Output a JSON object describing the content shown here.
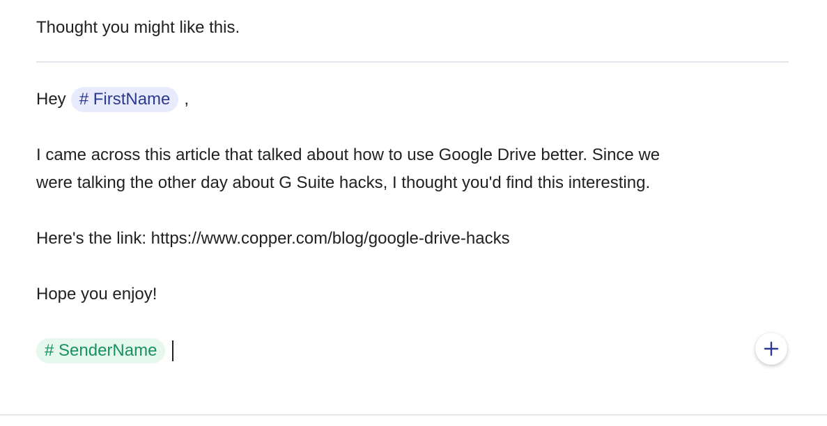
{
  "email": {
    "subject": "Thought you might like this.",
    "greeting_word": "Hey",
    "first_name_token": "# FirstName",
    "greeting_comma": ",",
    "paragraph1_line1": "I came across this article that talked about how to use Google Drive better. Since we",
    "paragraph1_line2": "were talking the other day about G Suite hacks, I thought you'd find this interesting.",
    "paragraph2": "Here's the link: https://www.copper.com/blog/google-drive-hacks",
    "paragraph3": "Hope you enjoy!",
    "sender_name_token": "# SenderName"
  },
  "toolbar": {
    "add_icon": "plus-icon"
  },
  "colors": {
    "first_name_chip_bg": "#e8ebfb",
    "first_name_chip_text": "#2b3a8f",
    "sender_chip_bg": "#e6f7ee",
    "sender_chip_text": "#17935b",
    "add_icon_color": "#2b3a8f",
    "divider": "#e3e6ea"
  }
}
